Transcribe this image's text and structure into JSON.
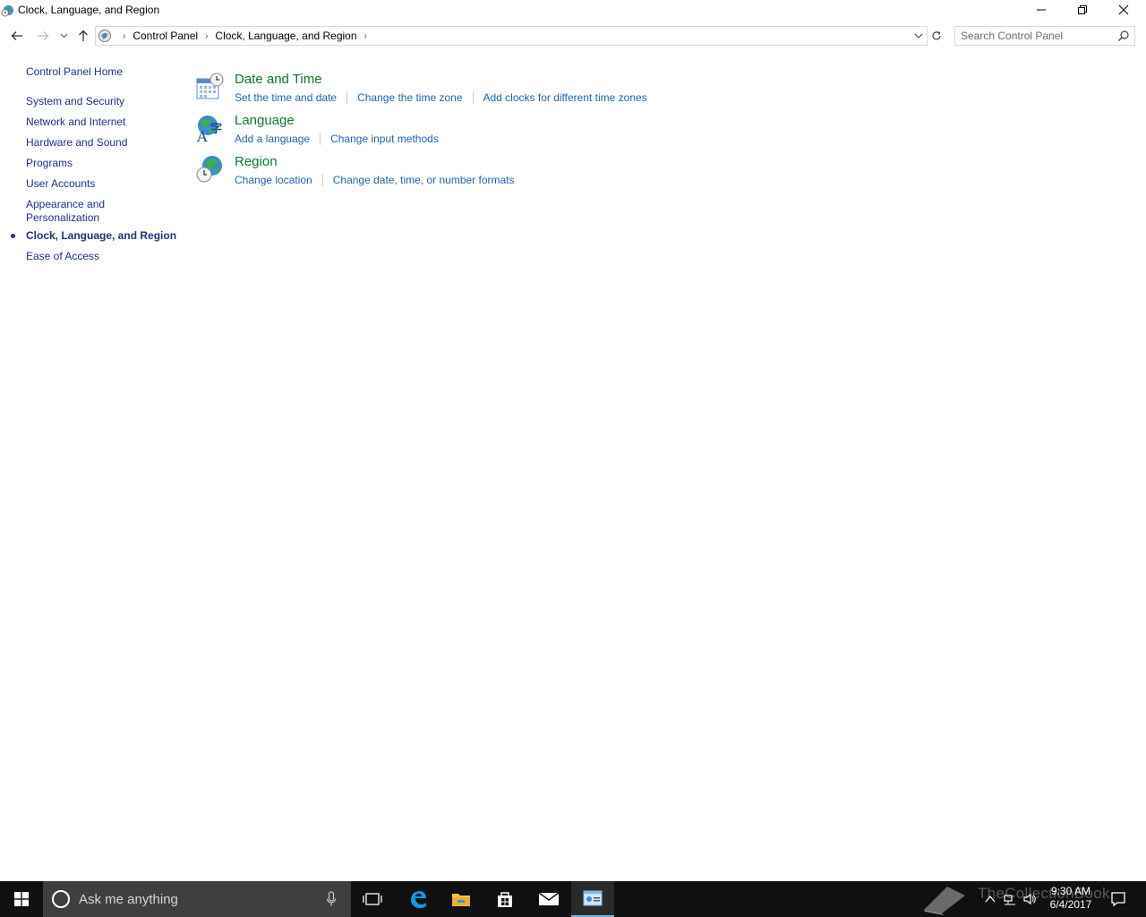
{
  "window": {
    "title": "Clock, Language, and Region",
    "app_icon": "clock-globe-icon",
    "controls": [
      "minimize-icon",
      "restore-icon",
      "close-icon"
    ]
  },
  "addressbar": {
    "breadcrumbs": [
      "Control Panel",
      "Clock, Language, and Region"
    ],
    "search_placeholder": "Search Control Panel"
  },
  "leftnav": {
    "home": "Control Panel Home",
    "items": [
      "System and Security",
      "Network and Internet",
      "Hardware and Sound",
      "Programs",
      "User Accounts",
      "Appearance and Personalization",
      "Clock, Language, and Region",
      "Ease of Access"
    ],
    "current_index": 6
  },
  "categories": [
    {
      "title": "Date and Time",
      "icon": "calendar-clock-icon",
      "links": [
        "Set the time and date",
        "Change the time zone",
        "Add clocks for different time zones"
      ]
    },
    {
      "title": "Language",
      "icon": "language-globe-icon",
      "links": [
        "Add a language",
        "Change input methods"
      ]
    },
    {
      "title": "Region",
      "icon": "region-globe-icon",
      "links": [
        "Change location",
        "Change date, time, or number formats"
      ]
    }
  ],
  "taskbar": {
    "search_placeholder": "Ask me anything",
    "watermark": "TheCollectionBook",
    "time": "9:30 AM",
    "date": "6/4/2017"
  },
  "colors": {
    "link": "#1e64b4",
    "category_title": "#0f7a2e",
    "nav_link": "#1e3287",
    "taskbar": "#101010"
  }
}
